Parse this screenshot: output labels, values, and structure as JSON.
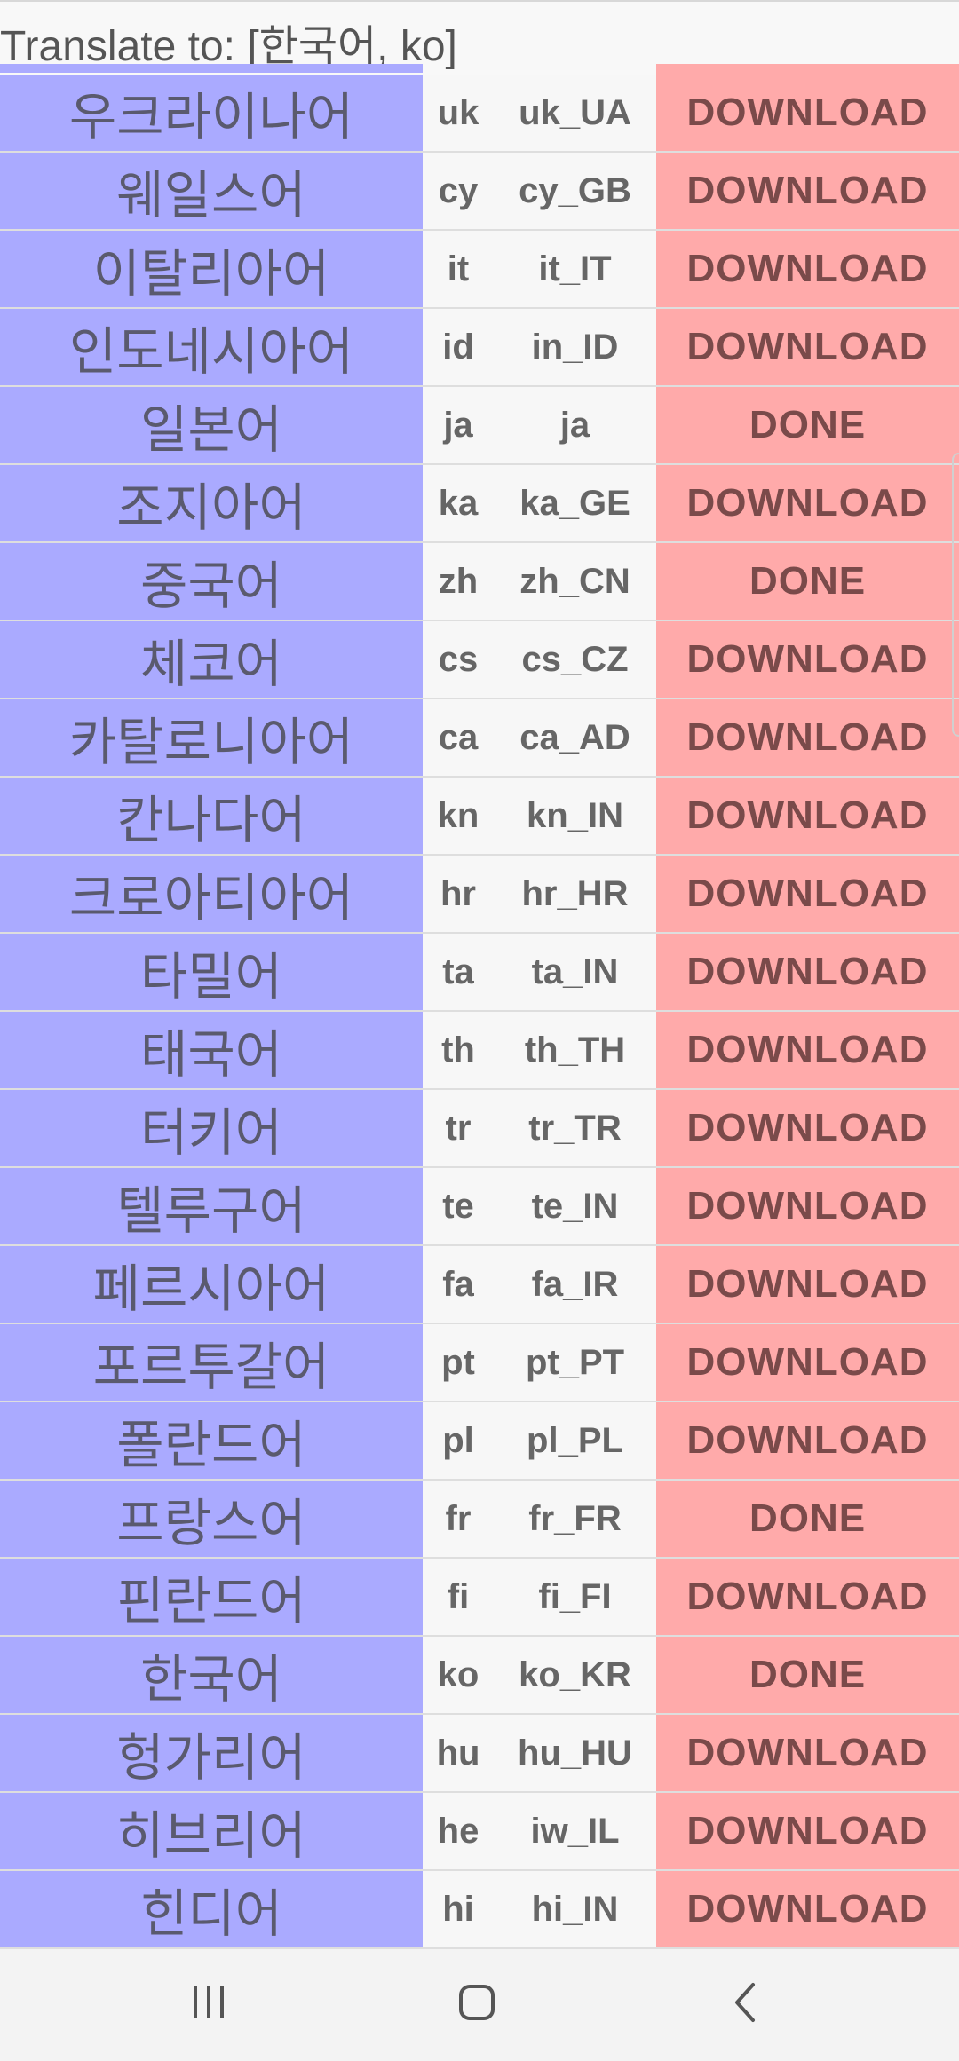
{
  "header": {
    "title": "Translate to: [한국어, ko]"
  },
  "columns": {
    "action_done": "DONE",
    "action_download": "DOWNLOAD"
  },
  "rows": [
    {
      "name": "우크라이나어",
      "code": "uk",
      "locale": "uk_UA",
      "action": "DOWNLOAD"
    },
    {
      "name": "웨일스어",
      "code": "cy",
      "locale": "cy_GB",
      "action": "DOWNLOAD"
    },
    {
      "name": "이탈리아어",
      "code": "it",
      "locale": "it_IT",
      "action": "DOWNLOAD"
    },
    {
      "name": "인도네시아어",
      "code": "id",
      "locale": "in_ID",
      "action": "DOWNLOAD"
    },
    {
      "name": "일본어",
      "code": "ja",
      "locale": "ja",
      "action": "DONE"
    },
    {
      "name": "조지아어",
      "code": "ka",
      "locale": "ka_GE",
      "action": "DOWNLOAD"
    },
    {
      "name": "중국어",
      "code": "zh",
      "locale": "zh_CN",
      "action": "DONE"
    },
    {
      "name": "체코어",
      "code": "cs",
      "locale": "cs_CZ",
      "action": "DOWNLOAD"
    },
    {
      "name": "카탈로니아어",
      "code": "ca",
      "locale": "ca_AD",
      "action": "DOWNLOAD"
    },
    {
      "name": "칸나다어",
      "code": "kn",
      "locale": "kn_IN",
      "action": "DOWNLOAD"
    },
    {
      "name": "크로아티아어",
      "code": "hr",
      "locale": "hr_HR",
      "action": "DOWNLOAD"
    },
    {
      "name": "타밀어",
      "code": "ta",
      "locale": "ta_IN",
      "action": "DOWNLOAD"
    },
    {
      "name": "태국어",
      "code": "th",
      "locale": "th_TH",
      "action": "DOWNLOAD"
    },
    {
      "name": "터키어",
      "code": "tr",
      "locale": "tr_TR",
      "action": "DOWNLOAD"
    },
    {
      "name": "텔루구어",
      "code": "te",
      "locale": "te_IN",
      "action": "DOWNLOAD"
    },
    {
      "name": "페르시아어",
      "code": "fa",
      "locale": "fa_IR",
      "action": "DOWNLOAD"
    },
    {
      "name": "포르투갈어",
      "code": "pt",
      "locale": "pt_PT",
      "action": "DOWNLOAD"
    },
    {
      "name": "폴란드어",
      "code": "pl",
      "locale": "pl_PL",
      "action": "DOWNLOAD"
    },
    {
      "name": "프랑스어",
      "code": "fr",
      "locale": "fr_FR",
      "action": "DONE"
    },
    {
      "name": "핀란드어",
      "code": "fi",
      "locale": "fi_FI",
      "action": "DOWNLOAD"
    },
    {
      "name": "한국어",
      "code": "ko",
      "locale": "ko_KR",
      "action": "DONE"
    },
    {
      "name": "헝가리어",
      "code": "hu",
      "locale": "hu_HU",
      "action": "DOWNLOAD"
    },
    {
      "name": "히브리어",
      "code": "he",
      "locale": "iw_IL",
      "action": "DOWNLOAD"
    },
    {
      "name": "힌디어",
      "code": "hi",
      "locale": "hi_IN",
      "action": "DOWNLOAD"
    }
  ],
  "navbar": {
    "recents_icon": "recents-icon",
    "home_icon": "home-icon",
    "back_icon": "back-icon"
  },
  "colors": {
    "name_bg": "#aaaaff",
    "action_bg": "#ffaaaa",
    "code_bg": "#f7f7f7"
  }
}
